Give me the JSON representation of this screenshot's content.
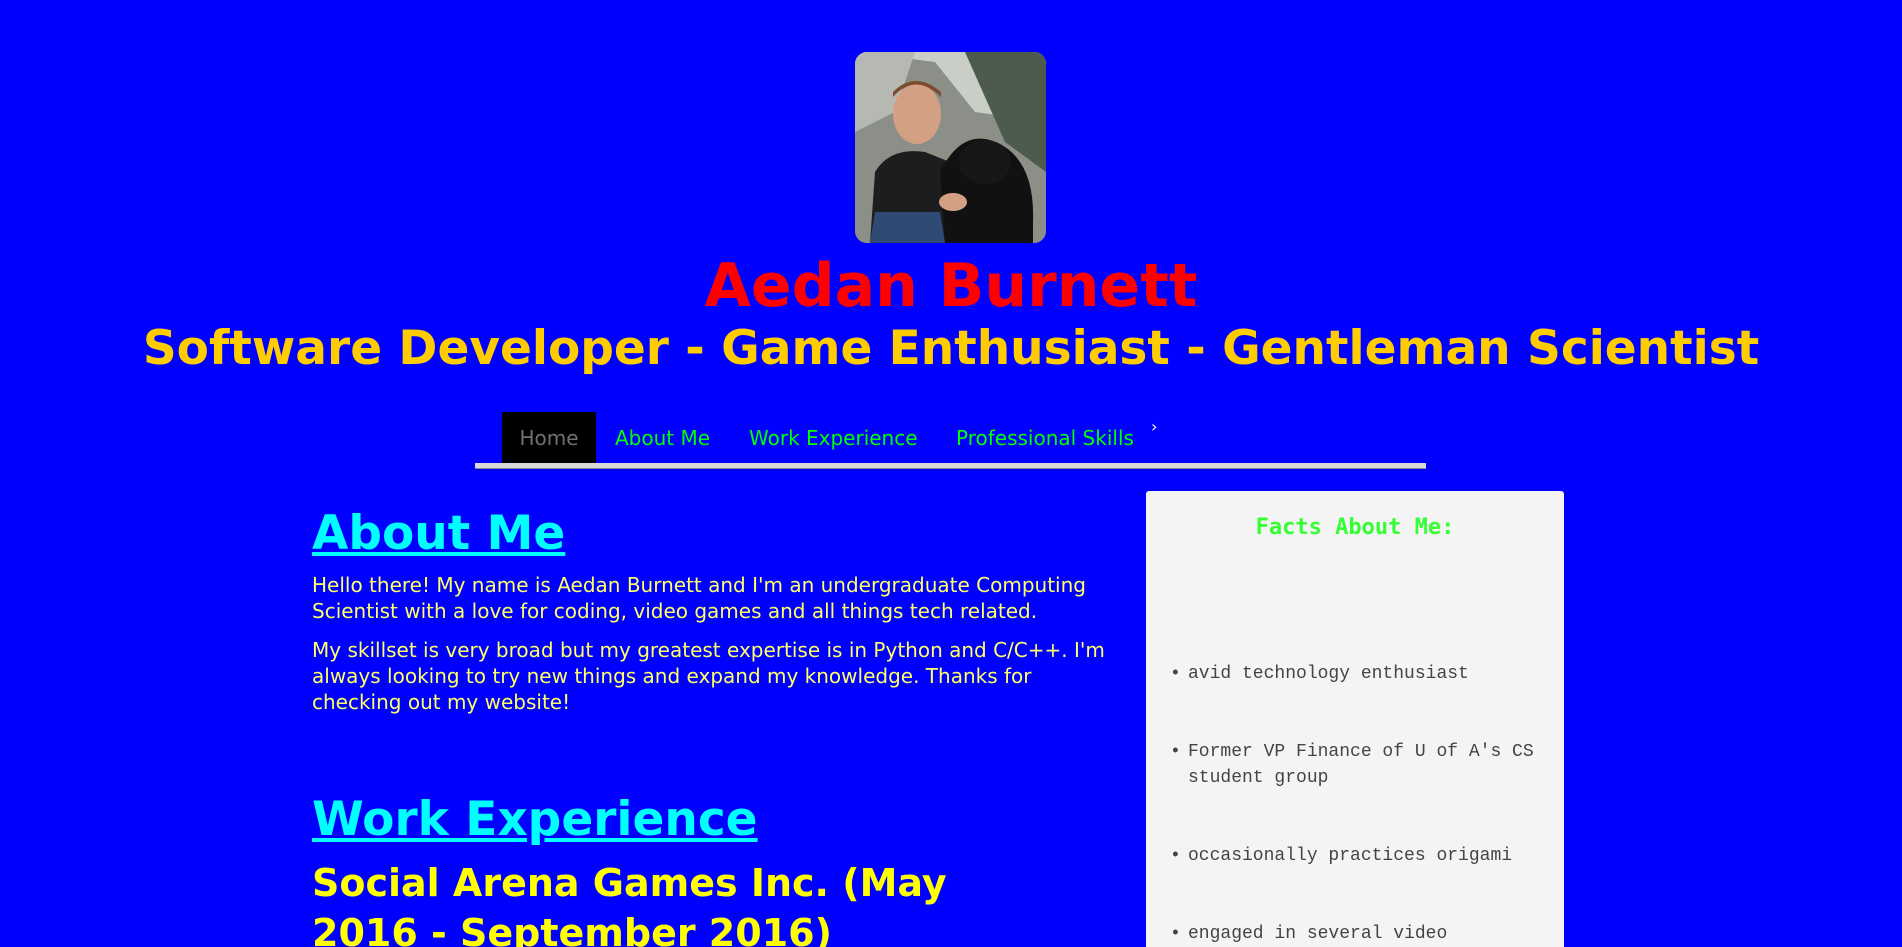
{
  "profile": {
    "photo_alt": "profile photo",
    "name": "Aedan Burnett",
    "tagline": "Software Developer - Game Enthusiast - Gentleman Scientist"
  },
  "nav": {
    "items": [
      {
        "label": "Home",
        "active": true
      },
      {
        "label": "About Me",
        "active": false
      },
      {
        "label": "Work Experience",
        "active": false
      },
      {
        "label": "Professional Skills",
        "active": false
      }
    ],
    "more_icon": "chevron-right-icon",
    "more_glyph": "›"
  },
  "about": {
    "title": "About Me",
    "paragraphs": [
      "Hello there! My name is Aedan Burnett and I'm an undergraduate Computing Scientist with a love for coding, video games and all things tech related.",
      "My skillset is very broad but my greatest expertise is in Python and C/C++. I'm always looking to try new things and expand my knowledge. Thanks for checking out my website!"
    ]
  },
  "work": {
    "title": "Work Experience",
    "job_title": "Social Arena Games Inc. (May 2016 - September 2016)"
  },
  "facts": {
    "title": "Facts About Me:",
    "items": [
      "avid technology enthusiast",
      "Former VP Finance of U of A's CS student group",
      "occasionally practices origami",
      "engaged in several video"
    ]
  },
  "colors": {
    "background": "#0000ff",
    "name": "#ff0000",
    "tagline": "#ffcc00",
    "nav_link": "#00ff00",
    "section_title": "#00ffff",
    "body_text": "#ffff66",
    "facts_title": "#33ff33"
  }
}
